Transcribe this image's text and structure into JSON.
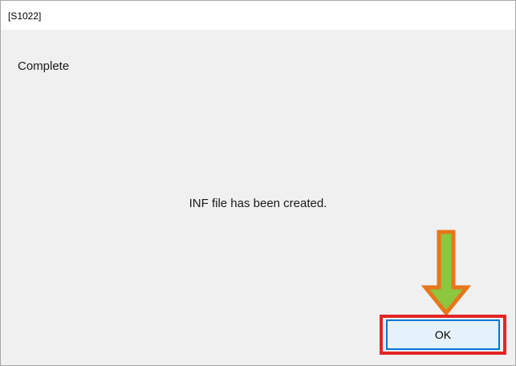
{
  "dialog": {
    "title": "[S1022]",
    "heading": "Complete",
    "message": "INF file has been created.",
    "ok_label": "OK"
  },
  "annotation": {
    "arrow_fill": "#8dc63f",
    "arrow_outline": "#e8761b",
    "highlight_color": "#e32626"
  }
}
